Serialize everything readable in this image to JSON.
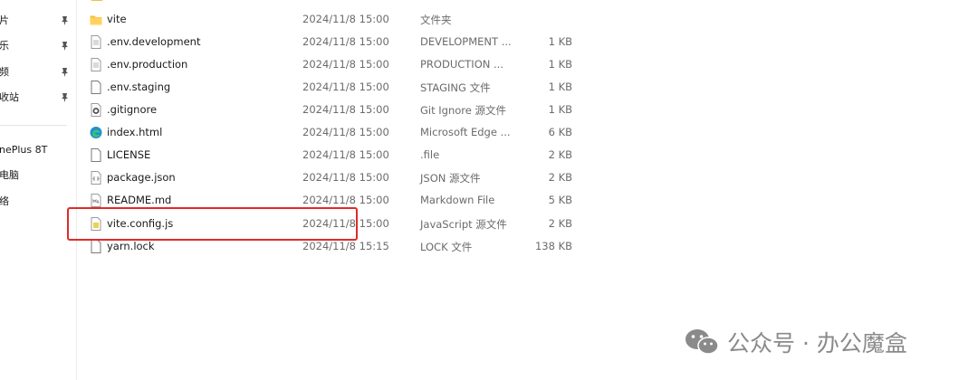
{
  "sidebar": {
    "items": [
      {
        "label": "片",
        "pinned": true
      },
      {
        "label": "乐",
        "pinned": true
      },
      {
        "label": "频",
        "pinned": true
      },
      {
        "label": "收站",
        "pinned": true
      },
      {
        "label": "nePlus 8T",
        "pinned": false
      },
      {
        "label": "电脑",
        "pinned": false
      },
      {
        "label": "络",
        "pinned": false
      }
    ]
  },
  "files": [
    {
      "name": "vite",
      "date": "2024/11/8 15:00",
      "type": "文件夹",
      "size": "",
      "icon": "folder-icon"
    },
    {
      "name": ".env.development",
      "date": "2024/11/8 15:00",
      "type": "DEVELOPMENT ...",
      "size": "1 KB",
      "icon": "text-file-icon"
    },
    {
      "name": ".env.production",
      "date": "2024/11/8 15:00",
      "type": "PRODUCTION ...",
      "size": "1 KB",
      "icon": "text-file-icon"
    },
    {
      "name": ".env.staging",
      "date": "2024/11/8 15:00",
      "type": "STAGING 文件",
      "size": "1 KB",
      "icon": "blank-file-icon"
    },
    {
      "name": ".gitignore",
      "date": "2024/11/8 15:00",
      "type": "Git Ignore 源文件",
      "size": "1 KB",
      "icon": "gear-file-icon"
    },
    {
      "name": "index.html",
      "date": "2024/11/8 15:00",
      "type": "Microsoft Edge ...",
      "size": "6 KB",
      "icon": "edge-icon"
    },
    {
      "name": "LICENSE",
      "date": "2024/11/8 15:00",
      "type": ".file",
      "size": "2 KB",
      "icon": "blank-file-icon"
    },
    {
      "name": "package.json",
      "date": "2024/11/8 15:00",
      "type": "JSON 源文件",
      "size": "2 KB",
      "icon": "json-file-icon"
    },
    {
      "name": "README.md",
      "date": "2024/11/8 15:00",
      "type": "Markdown File",
      "size": "5 KB",
      "icon": "markdown-file-icon"
    },
    {
      "name": "vite.config.js",
      "date": "2024/11/8 15:00",
      "type": "JavaScript 源文件",
      "size": "2 KB",
      "icon": "js-file-icon"
    },
    {
      "name": "yarn.lock",
      "date": "2024/11/8 15:15",
      "type": "LOCK 文件",
      "size": "138 KB",
      "icon": "blank-file-icon"
    }
  ],
  "highlighted_file": "vite.config.js",
  "watermark": {
    "text": "公众号 · 办公魔盒",
    "icon": "wechat-icon"
  },
  "colors": {
    "highlight": "#e02a2a",
    "folder": "#f4bf40",
    "edge": "#1e8fd6"
  }
}
